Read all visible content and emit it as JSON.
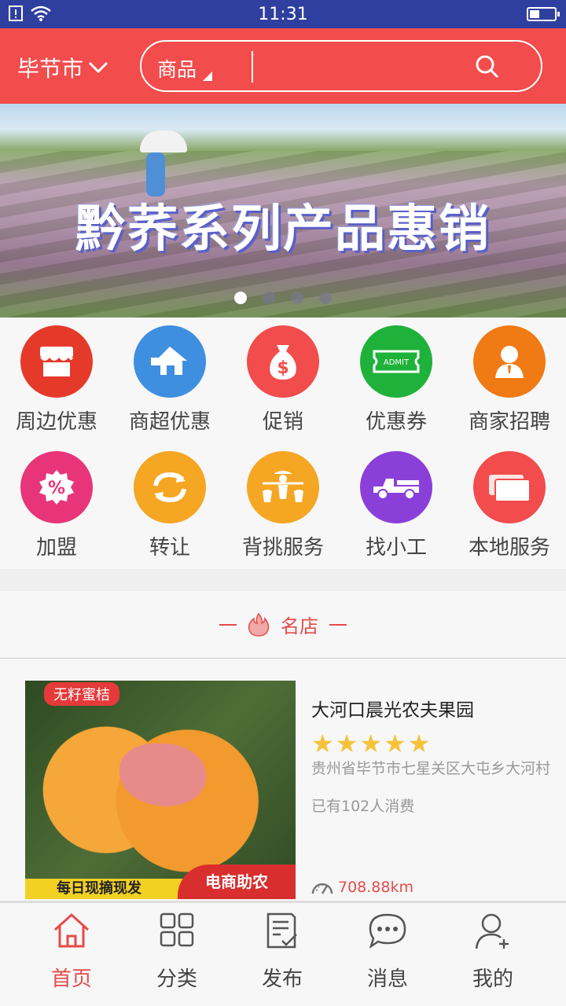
{
  "status_bar": {
    "time": "11:31"
  },
  "header": {
    "city": "毕节市",
    "search_category": "商品",
    "search_placeholder": "",
    "accent": "#f24c4c"
  },
  "banner": {
    "title": "黔荞系列产品惠销",
    "slides": 4,
    "active_slide": 1
  },
  "categories": [
    {
      "label": "周边优惠",
      "icon": "store-icon",
      "color": "#e53a2a"
    },
    {
      "label": "商超优惠",
      "icon": "supermarket-icon",
      "color": "#3f8fe0"
    },
    {
      "label": "促销",
      "icon": "money-bag-icon",
      "color": "#f24c4c"
    },
    {
      "label": "优惠券",
      "icon": "ticket-icon",
      "color": "#1fb23a"
    },
    {
      "label": "商家招聘",
      "icon": "person-icon",
      "color": "#f07a14"
    },
    {
      "label": "加盟",
      "icon": "percent-icon",
      "color": "#e8357a"
    },
    {
      "label": "转让",
      "icon": "refresh-icon",
      "color": "#f5a623"
    },
    {
      "label": "背挑服务",
      "icon": "porter-icon",
      "color": "#f5a623"
    },
    {
      "label": "找小工",
      "icon": "truck-icon",
      "color": "#8a3fd9"
    },
    {
      "label": "本地服务",
      "icon": "cards-icon",
      "color": "#f24c4c"
    }
  ],
  "section": {
    "title": "名店"
  },
  "shop": {
    "name": "大河口晨光农夫果园",
    "rating": 5,
    "address": "贵州省毕节市七星关区大屯乡大河村",
    "consumption": "已有102人消费",
    "distance": "708.88km",
    "image_tag": "无籽蜜桔",
    "image_banner": "每日现摘现发",
    "image_badge": "电商助农"
  },
  "tabbar": [
    {
      "label": "首页",
      "icon": "home-icon",
      "active": true
    },
    {
      "label": "分类",
      "icon": "grid-icon",
      "active": false
    },
    {
      "label": "发布",
      "icon": "edit-note-icon",
      "active": false
    },
    {
      "label": "消息",
      "icon": "chat-bubble-icon",
      "active": false
    },
    {
      "label": "我的",
      "icon": "user-add-icon",
      "active": false
    }
  ]
}
